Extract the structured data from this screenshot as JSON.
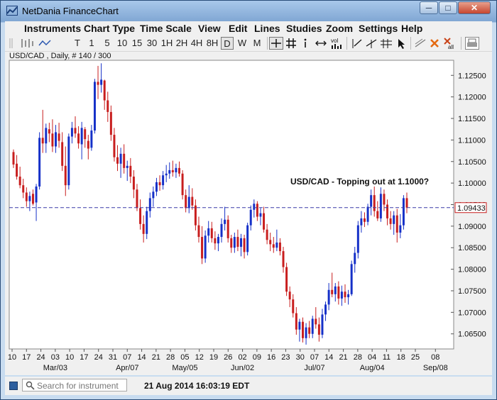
{
  "window": {
    "title": "NetDania FinanceChart",
    "controls": {
      "minimize": "─",
      "maximize": "□",
      "close": "✕"
    }
  },
  "menu": {
    "items": [
      "Instruments",
      "Chart Type",
      "Time Scale",
      "View",
      "Edit",
      "Lines",
      "Studies",
      "Zoom",
      "Settings",
      "Help"
    ]
  },
  "toolbar": {
    "items": [
      "T",
      "1",
      "5",
      "10",
      "15",
      "30",
      "1H",
      "2H",
      "4H",
      "8H",
      "D",
      "W",
      "M"
    ],
    "active": "D",
    "vol_label": "vol",
    "all_label": "all",
    "icons": [
      "crosshair-icon",
      "grid-icon",
      "info-icon",
      "pan-icon",
      "volume-icon",
      "line-tools-icon",
      "delete-icon",
      "delete-all-icon",
      "print-icon"
    ]
  },
  "chart": {
    "label": "USD/CAD , Daily, # 140 / 300",
    "annotation": "USD/CAD - Topping out at 1.1000?",
    "last_price_label": "1.09433",
    "colors": {
      "up": "#1530c8",
      "down": "#c81e1e",
      "hline": "#3a3aa8",
      "bg": "#ffffff"
    }
  },
  "chart_data": {
    "type": "candlestick",
    "title": "USD/CAD , Daily, # 140 / 300",
    "ylim": [
      1.0615,
      1.1285
    ],
    "y_ticks": [
      "1.12500",
      "1.12000",
      "1.11500",
      "1.11000",
      "1.10500",
      "1.10000",
      "1.09500",
      "1.09000",
      "1.08500",
      "1.08000",
      "1.07500",
      "1.07000",
      "1.06500"
    ],
    "x_day_labels": [
      "10",
      "17",
      "24",
      "03",
      "10",
      "17",
      "24",
      "31",
      "07",
      "14",
      "21",
      "28",
      "05",
      "12",
      "19",
      "26",
      "02",
      "09",
      "16",
      "23",
      "30",
      "07",
      "14",
      "21",
      "28",
      "04",
      "11",
      "18",
      "25",
      "08"
    ],
    "x_month_labels": [
      "Mar/03",
      "Apr/07",
      "May/05",
      "Jun/02",
      "Jul/07",
      "Aug/04",
      "Sep/08"
    ],
    "reference_line": 1.0943,
    "annotation": "USD/CAD - Topping out at 1.1000?",
    "candles": [
      [
        1.1072,
        1.1078,
        1.1035,
        1.1043
      ],
      [
        1.1045,
        1.1065,
        1.1008,
        1.1015
      ],
      [
        1.1015,
        1.1038,
        1.0988,
        1.0995
      ],
      [
        1.0995,
        1.101,
        1.0965,
        1.0978
      ],
      [
        1.0978,
        1.099,
        1.0945,
        1.0958
      ],
      [
        1.0958,
        1.098,
        1.0935,
        1.097
      ],
      [
        1.0975,
        1.0985,
        1.0948,
        1.0952
      ],
      [
        1.0955,
        1.0998,
        1.0912,
        1.0992
      ],
      [
        1.0992,
        1.1118,
        1.0985,
        1.1105
      ],
      [
        1.1105,
        1.117,
        1.107,
        1.1092
      ],
      [
        1.1092,
        1.1138,
        1.107,
        1.1128
      ],
      [
        1.1125,
        1.114,
        1.1095,
        1.1115
      ],
      [
        1.1115,
        1.1148,
        1.1072,
        1.1085
      ],
      [
        1.1085,
        1.1135,
        1.107,
        1.1118
      ],
      [
        1.1115,
        1.114,
        1.1082,
        1.1098
      ],
      [
        1.1095,
        1.1118,
        1.1028,
        1.104
      ],
      [
        1.104,
        1.1085,
        1.097,
        1.0995
      ],
      [
        1.0995,
        1.1115,
        1.0985,
        1.1108
      ],
      [
        1.1108,
        1.1142,
        1.1092,
        1.1128
      ],
      [
        1.1128,
        1.1155,
        1.1105,
        1.1115
      ],
      [
        1.1115,
        1.1132,
        1.108,
        1.1092
      ],
      [
        1.109,
        1.1142,
        1.1055,
        1.1128
      ],
      [
        1.1125,
        1.113,
        1.1082,
        1.1102
      ],
      [
        1.1098,
        1.1112,
        1.1055,
        1.108
      ],
      [
        1.1082,
        1.1135,
        1.1075,
        1.1122
      ],
      [
        1.1122,
        1.1242,
        1.1115,
        1.1235
      ],
      [
        1.1235,
        1.1272,
        1.1195,
        1.1228
      ],
      [
        1.1228,
        1.1278,
        1.121,
        1.124
      ],
      [
        1.1238,
        1.124,
        1.117,
        1.1192
      ],
      [
        1.1192,
        1.1212,
        1.1142,
        1.1165
      ],
      [
        1.1165,
        1.118,
        1.1098,
        1.1112
      ],
      [
        1.1112,
        1.1128,
        1.105,
        1.106
      ],
      [
        1.106,
        1.1088,
        1.1028,
        1.1045
      ],
      [
        1.1045,
        1.1082,
        1.1012,
        1.1068
      ],
      [
        1.1068,
        1.109,
        1.1022,
        1.1035
      ],
      [
        1.1035,
        1.1052,
        1.1005,
        1.104
      ],
      [
        1.104,
        1.1058,
        1.1,
        1.1015
      ],
      [
        1.1015,
        1.103,
        1.0965,
        1.0985
      ],
      [
        1.0985,
        1.0998,
        1.0935,
        1.0942
      ],
      [
        1.0942,
        1.0962,
        1.0892,
        1.0905
      ],
      [
        1.0905,
        1.0925,
        1.0862,
        1.0882
      ],
      [
        1.0882,
        1.0945,
        1.087,
        1.0935
      ],
      [
        1.0935,
        1.0978,
        1.092,
        1.0965
      ],
      [
        1.0965,
        1.0992,
        1.0945,
        1.098
      ],
      [
        1.098,
        1.1012,
        1.097,
        1.1002
      ],
      [
        1.1002,
        1.1018,
        1.0982,
        1.0995
      ],
      [
        1.0995,
        1.1028,
        1.0985,
        1.1018
      ],
      [
        1.1018,
        1.1042,
        1.1002,
        1.1022
      ],
      [
        1.1022,
        1.1048,
        1.101,
        1.103
      ],
      [
        1.103,
        1.1052,
        1.1015,
        1.1025
      ],
      [
        1.1025,
        1.1045,
        1.1012,
        1.1035
      ],
      [
        1.1035,
        1.105,
        1.1015,
        1.1022
      ],
      [
        1.1022,
        1.103,
        1.0962,
        1.0972
      ],
      [
        1.0972,
        1.0985,
        1.0932,
        1.0942
      ],
      [
        1.0942,
        1.0995,
        1.093,
        1.0968
      ],
      [
        1.0968,
        1.0988,
        1.0938,
        1.0948
      ],
      [
        1.0948,
        1.0962,
        1.089,
        1.0902
      ],
      [
        1.0902,
        1.0922,
        1.0862,
        1.0875
      ],
      [
        1.0875,
        1.09,
        1.0812,
        1.0825
      ],
      [
        1.0825,
        1.089,
        1.0815,
        1.0878
      ],
      [
        1.0878,
        1.0912,
        1.0862,
        1.0895
      ],
      [
        1.0895,
        1.091,
        1.0862,
        1.0872
      ],
      [
        1.0872,
        1.0888,
        1.0845,
        1.086
      ],
      [
        1.086,
        1.0882,
        1.0842,
        1.0875
      ],
      [
        1.0875,
        1.0918,
        1.0862,
        1.0905
      ],
      [
        1.0905,
        1.0945,
        1.089,
        1.0915
      ],
      [
        1.0915,
        1.0925,
        1.0862,
        1.0872
      ],
      [
        1.0872,
        1.088,
        1.0838,
        1.085
      ],
      [
        1.085,
        1.0885,
        1.0838,
        1.0875
      ],
      [
        1.0875,
        1.0892,
        1.0842,
        1.0852
      ],
      [
        1.0852,
        1.0882,
        1.083,
        1.0872
      ],
      [
        1.0872,
        1.088,
        1.0825,
        1.084
      ],
      [
        1.084,
        1.0908,
        1.0832,
        1.0902
      ],
      [
        1.0902,
        1.0948,
        1.089,
        1.0938
      ],
      [
        1.0938,
        1.0962,
        1.092,
        1.0952
      ],
      [
        1.0952,
        1.0958,
        1.0912,
        1.0922
      ],
      [
        1.0922,
        1.0942,
        1.0902,
        1.093
      ],
      [
        1.093,
        1.0945,
        1.0885,
        1.0892
      ],
      [
        1.0892,
        1.0905,
        1.0858,
        1.0868
      ],
      [
        1.0868,
        1.0885,
        1.0842,
        1.0858
      ],
      [
        1.0858,
        1.0875,
        1.0838,
        1.085
      ],
      [
        1.085,
        1.0892,
        1.0842,
        1.0862
      ],
      [
        1.0862,
        1.0872,
        1.0832,
        1.0842
      ],
      [
        1.0842,
        1.0852,
        1.0792,
        1.0805
      ],
      [
        1.0805,
        1.0815,
        1.0738,
        1.0748
      ],
      [
        1.0748,
        1.076,
        1.0712,
        1.073
      ],
      [
        1.073,
        1.0742,
        1.0688,
        1.0698
      ],
      [
        1.0698,
        1.0712,
        1.0648,
        1.066
      ],
      [
        1.066,
        1.0685,
        1.0632,
        1.0678
      ],
      [
        1.0678,
        1.0688,
        1.063,
        1.064
      ],
      [
        1.064,
        1.0675,
        1.0625,
        1.0665
      ],
      [
        1.0665,
        1.068,
        1.064,
        1.065
      ],
      [
        1.065,
        1.0692,
        1.064,
        1.0685
      ],
      [
        1.0685,
        1.0712,
        1.0662,
        1.0672
      ],
      [
        1.0672,
        1.0688,
        1.0632,
        1.0648
      ],
      [
        1.0648,
        1.0708,
        1.064,
        1.0695
      ],
      [
        1.0695,
        1.0725,
        1.068,
        1.0718
      ],
      [
        1.0718,
        1.0768,
        1.0705,
        1.0752
      ],
      [
        1.0752,
        1.0792,
        1.0735,
        1.0742
      ],
      [
        1.0742,
        1.0768,
        1.0725,
        1.076
      ],
      [
        1.076,
        1.0772,
        1.0718,
        1.0732
      ],
      [
        1.0732,
        1.0762,
        1.0715,
        1.0748
      ],
      [
        1.0748,
        1.0765,
        1.0722,
        1.0735
      ],
      [
        1.0735,
        1.0752,
        1.0718,
        1.0742
      ],
      [
        1.0742,
        1.082,
        1.0738,
        1.0812
      ],
      [
        1.0812,
        1.0852,
        1.0792,
        1.0838
      ],
      [
        1.0838,
        1.0912,
        1.0825,
        1.0902
      ],
      [
        1.0902,
        1.0935,
        1.0885,
        1.0918
      ],
      [
        1.0918,
        1.0932,
        1.0898,
        1.091
      ],
      [
        1.091,
        1.0952,
        1.0902,
        1.0945
      ],
      [
        1.0945,
        1.0985,
        1.0925,
        1.0972
      ],
      [
        1.0972,
        1.0992,
        1.0922,
        1.0935
      ],
      [
        1.0935,
        1.0958,
        1.0912,
        1.0918
      ],
      [
        1.0918,
        1.099,
        1.091,
        1.0975
      ],
      [
        1.0975,
        1.0985,
        1.0935,
        1.095
      ],
      [
        1.095,
        1.0962,
        1.0902,
        1.0918
      ],
      [
        1.0918,
        1.0935,
        1.0892,
        1.0905
      ],
      [
        1.0905,
        1.0935,
        1.088,
        1.0925
      ],
      [
        1.0925,
        1.094,
        1.0862,
        1.0885
      ],
      [
        1.0885,
        1.0928,
        1.0872,
        1.0902
      ],
      [
        1.0902,
        1.0972,
        1.0892,
        1.0965
      ],
      [
        1.0965,
        1.0978,
        1.093,
        1.0943
      ]
    ]
  },
  "status": {
    "search_placeholder": "Search for instrument",
    "timestamp": "21 Aug 2014 16:03:19 EDT"
  }
}
